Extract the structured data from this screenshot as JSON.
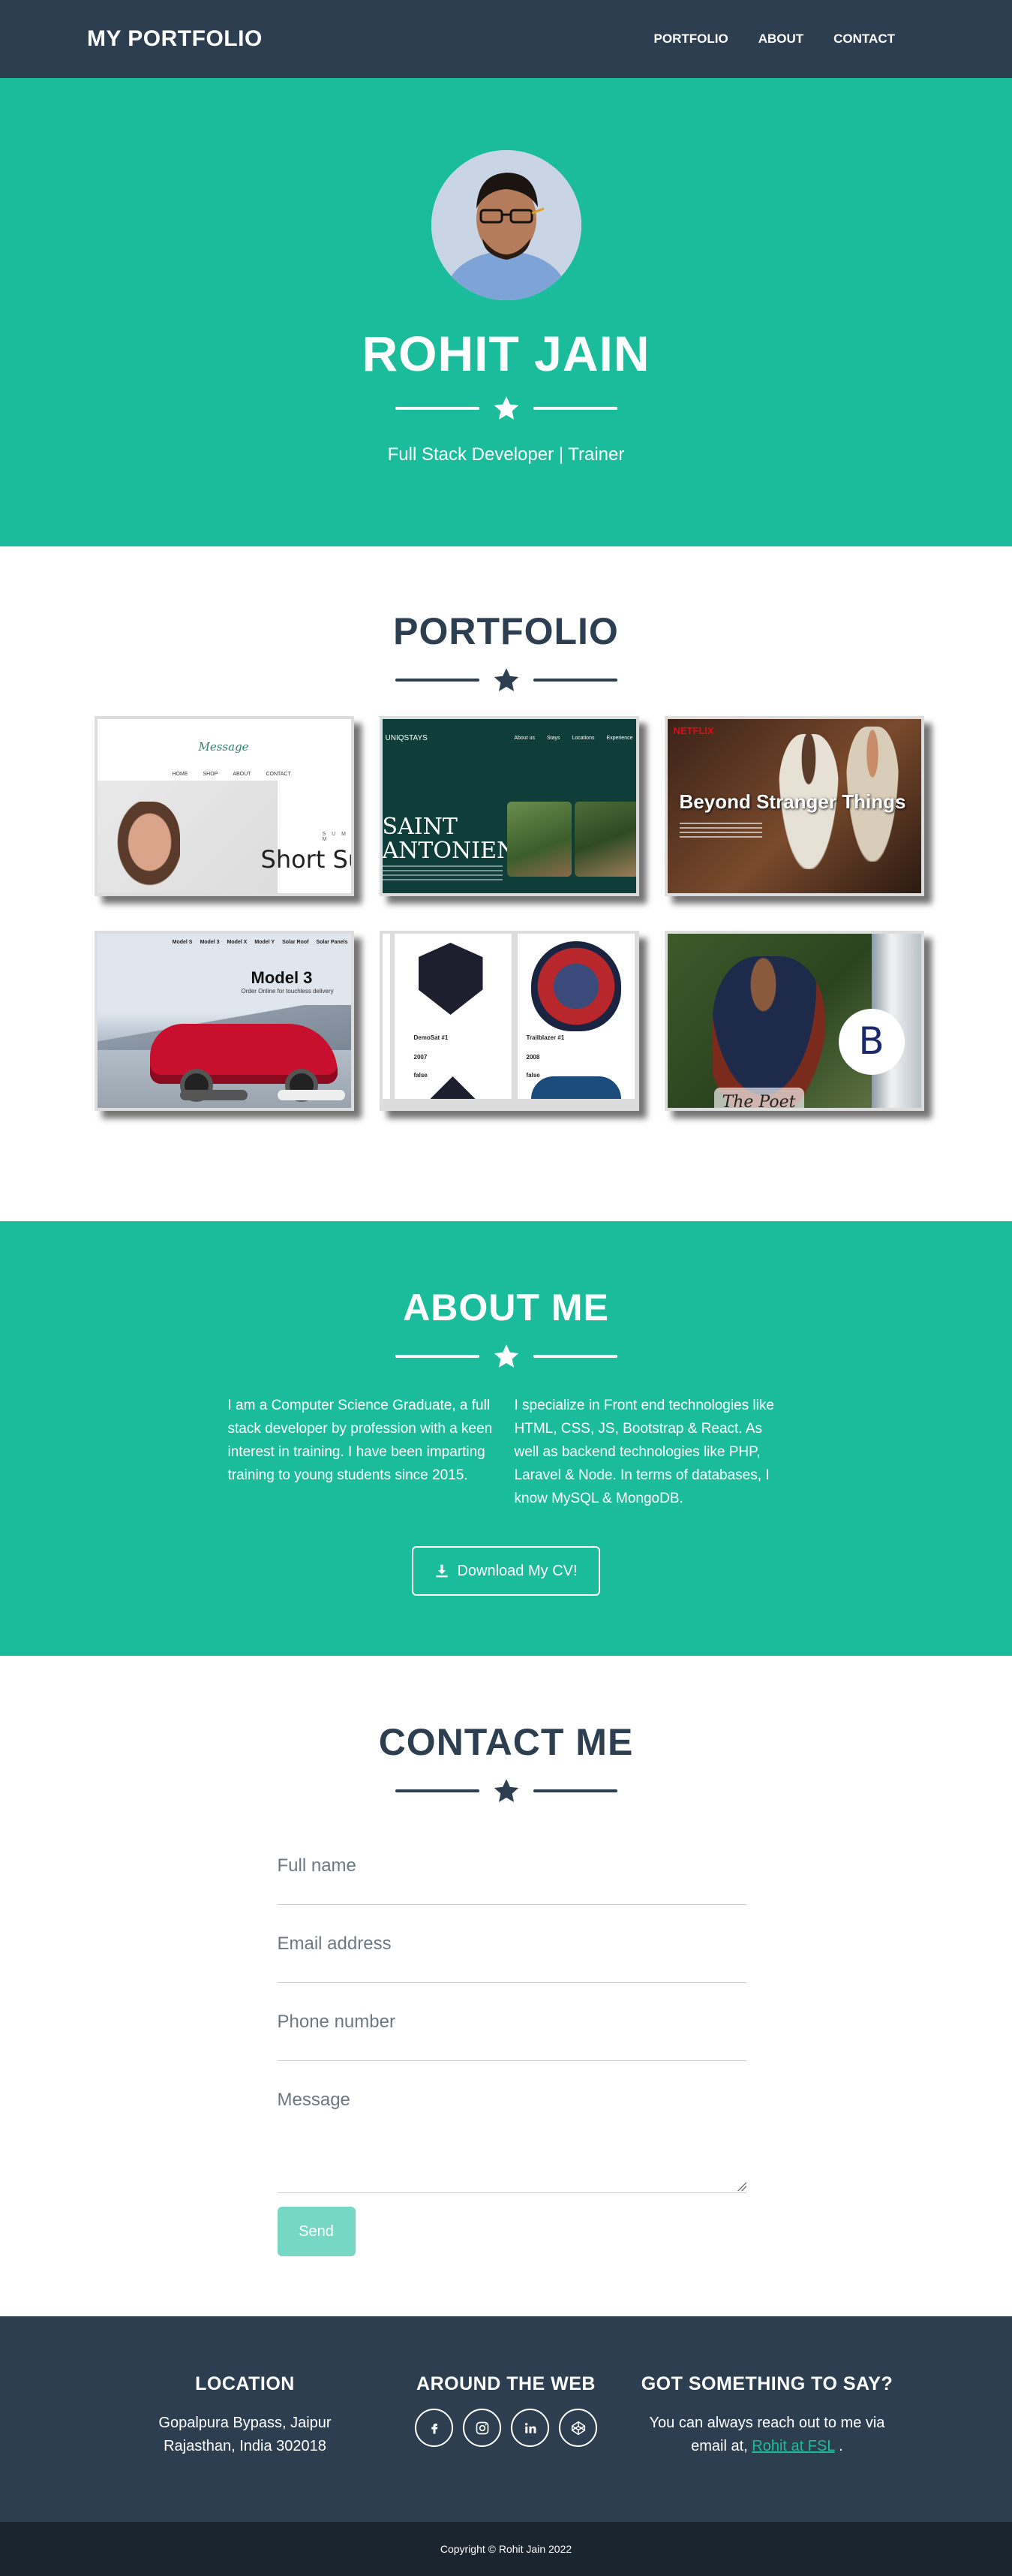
{
  "nav": {
    "brand": "MY PORTFOLIO",
    "links": [
      "PORTFOLIO",
      "ABOUT",
      "CONTACT"
    ]
  },
  "hero": {
    "name": "ROHIT JAIN",
    "subtitle": "Full Stack Developer | Trainer"
  },
  "portfolio": {
    "title": "PORTFOLIO",
    "cards": [
      {
        "logo": "Message",
        "nav": [
          "HOME",
          "SHOP",
          "ABOUT",
          "CONTACT"
        ],
        "headline": "Short Su",
        "tag": "S U M M"
      },
      {
        "logo": "UNIQSTAYS",
        "nav": [
          "About us",
          "Stays",
          "Locations",
          "Experience"
        ],
        "headline": "SAINT ANTONIEN"
      },
      {
        "logo": "NETFLIX",
        "headline": "Beyond Stranger Things"
      },
      {
        "tabs": [
          "Model S",
          "Model 3",
          "Model X",
          "Model Y",
          "Solar Roof",
          "Solar Panels"
        ],
        "headline": "Model 3",
        "sub": "Order Online for touchless delivery"
      },
      {
        "labels": [
          "DemoSat #1",
          "2007",
          "false",
          "Trailblazer #1",
          "2008",
          "false"
        ]
      },
      {
        "caption": "The Poet",
        "monogram": "B"
      }
    ]
  },
  "about": {
    "title": "ABOUT ME",
    "col1": "I am a Computer Science Graduate, a full stack developer by profession with a keen interest in training. I have been imparting training to young students since 2015.",
    "col2": "I specialize in Front end technologies like HTML, CSS, JS, Bootstrap & React. As well as backend technologies like PHP, Laravel & Node. In terms of databases, I know MySQL & MongoDB.",
    "cv_button": "Download My CV!"
  },
  "contact": {
    "title": "CONTACT ME",
    "fullname_placeholder": "Full name",
    "email_placeholder": "Email address",
    "phone_placeholder": "Phone number",
    "message_placeholder": "Message",
    "send_label": "Send"
  },
  "footer": {
    "location_title": "LOCATION",
    "location_line1": "Gopalpura Bypass, Jaipur",
    "location_line2": "Rajasthan, India 302018",
    "web_title": "AROUND THE WEB",
    "socials": [
      "facebook-icon",
      "instagram-icon",
      "linkedin-icon",
      "codepen-icon"
    ],
    "say_title": "GOT SOMETHING TO SAY?",
    "say_text": "You can always reach out to me via email at,",
    "say_link": "Rohit at FSL",
    "say_end": ".",
    "copyright": "Copyright © Rohit Jain 2022"
  },
  "colors": {
    "primary": "#1abc9c",
    "dark": "#2c3e50",
    "darker": "#1a252f"
  }
}
